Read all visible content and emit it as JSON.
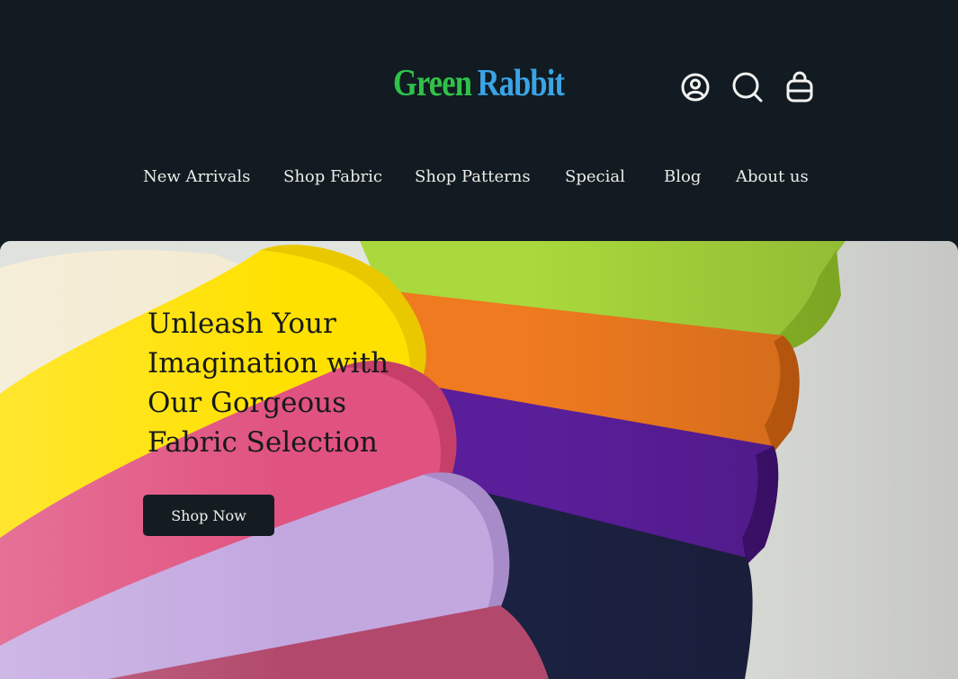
{
  "brand": {
    "word1": "Green",
    "word2": "Rabbit",
    "colors": {
      "green": "#2fc24a",
      "blue": "#3aa4e6"
    }
  },
  "header_icons": [
    {
      "name": "account-icon"
    },
    {
      "name": "search-icon"
    },
    {
      "name": "bag-icon"
    }
  ],
  "nav": {
    "items": [
      {
        "label": "New Arrivals"
      },
      {
        "label": "Shop Fabric"
      },
      {
        "label": "Shop Patterns"
      },
      {
        "label": "Special"
      },
      {
        "label": "Blog"
      },
      {
        "label": "About us"
      }
    ]
  },
  "hero": {
    "title": "Unleash Your Imagination with Our Gorgeous Fabric Selection",
    "cta_label": "Shop Now",
    "fabric_colors": [
      "#f3ead0",
      "#ffe100",
      "#e0527f",
      "#c3a8e0",
      "#a8d83a",
      "#ef7a1f",
      "#5a1e9a",
      "#1b2140",
      "#b2496d"
    ]
  },
  "colors": {
    "header_bg": "#111b21",
    "nav_text": "#ecece8",
    "button_bg": "#141c22"
  }
}
